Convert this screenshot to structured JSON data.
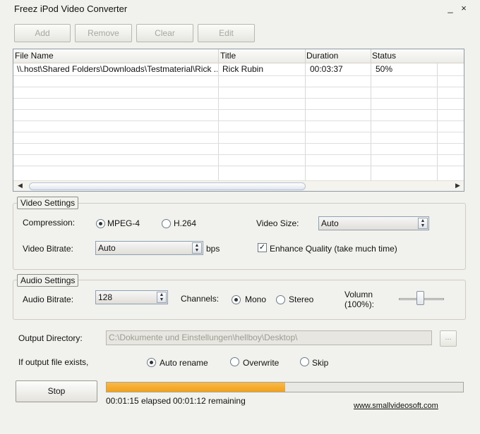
{
  "window": {
    "title": "Freez iPod Video Converter",
    "minimize": "_",
    "close": "×"
  },
  "toolbar": [
    {
      "name": "add-button",
      "label": "Add"
    },
    {
      "name": "remove-button",
      "label": "Remove"
    },
    {
      "name": "clear-button",
      "label": "Clear"
    },
    {
      "name": "edit-button",
      "label": "Edit"
    }
  ],
  "file_list": {
    "columns": [
      "File Name",
      "Title",
      "Duration",
      "Status"
    ],
    "rows": [
      {
        "file_name": "\\\\.host\\Shared Folders\\Downloads\\Testmaterial\\Rick ...",
        "title": "Rick Rubin",
        "duration": "00:03:37",
        "status": "50%"
      }
    ],
    "scroll_left": "◀",
    "scroll_right": "▶"
  },
  "video": {
    "group_label": "Video Settings",
    "compression_label": "Compression:",
    "compression_options": [
      "MPEG-4",
      "H.264"
    ],
    "compression_selected": "MPEG-4",
    "size_label": "Video Size:",
    "size_value": "Auto",
    "bitrate_label": "Video Bitrate:",
    "bitrate_value": "Auto",
    "bitrate_unit": "bps",
    "enhance_label": "Enhance Quality (take much time)",
    "enhance_checked": true
  },
  "audio": {
    "group_label": "Audio Settings",
    "bitrate_label": "Audio Bitrate:",
    "bitrate_value": "128",
    "channels_label": "Channels:",
    "channel_options": [
      "Mono",
      "Stereo"
    ],
    "channel_selected": "Mono",
    "volume_label_1": "Volumn",
    "volume_label_2": "(100%):",
    "volume_level": 1.0
  },
  "output": {
    "dir_label": "Output Directory:",
    "dir_value": "C:\\Dokumente und Einstellungen\\hellboy\\Desktop\\",
    "browse_label": "...",
    "exists_label": "If output file exists,",
    "exists_options": [
      "Auto rename",
      "Overwrite",
      "Skip"
    ],
    "exists_selected": "Auto rename"
  },
  "progress": {
    "stop_label": "Stop",
    "fraction": 0.5,
    "elapsed": "00:01:15 elapsed",
    "remaining": "00:01:12 remaining",
    "website": "www.smallvideosoft.com",
    "accent_color": "#f3a019"
  }
}
